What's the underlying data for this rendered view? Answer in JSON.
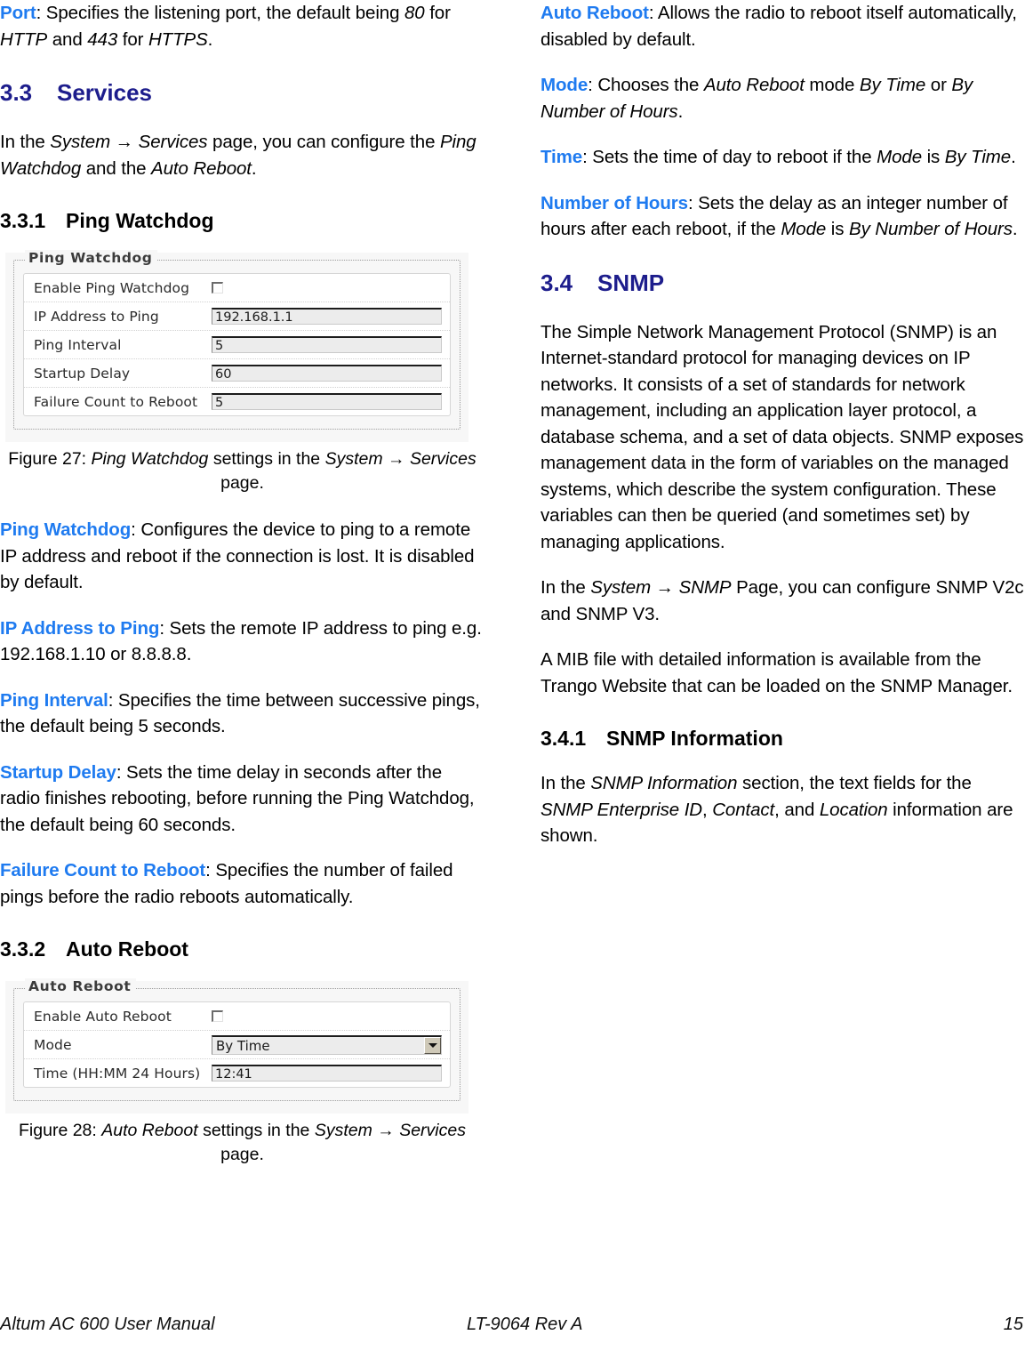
{
  "colors": {
    "term_blue": "#1f7bf0",
    "heading_navy": "#1d1d8c",
    "body_black": "#000000"
  },
  "left_column": {
    "port_para": {
      "term": "Port",
      "p1": ": Specifies the listening port, the default being ",
      "i1": "80",
      "p2": " for ",
      "i2": "HTTP",
      "p3": " and ",
      "i3": "443",
      "p4": " for ",
      "i4": "HTTPS",
      "p5": "."
    },
    "section_33": {
      "number": "3.3",
      "title": "Services"
    },
    "services_intro": {
      "p1": "In the ",
      "i1": "System",
      "arrow": " → ",
      "i2": "Services",
      "p2": " page, you can configure the ",
      "i3": "Ping Watchdog",
      "p3": " and the ",
      "i4": "Auto Reboot",
      "p4": "."
    },
    "heading_331": {
      "number": "3.3.1",
      "title": "Ping Watchdog"
    },
    "figure27": {
      "panel_title": "Ping Watchdog",
      "rows": [
        {
          "label": "Enable Ping Watchdog",
          "control": "checkbox",
          "value": ""
        },
        {
          "label": "IP Address to Ping",
          "control": "text",
          "value": "192.168.1.1"
        },
        {
          "label": "Ping Interval",
          "control": "text",
          "value": "5"
        },
        {
          "label": "Startup Delay",
          "control": "text",
          "value": "60"
        },
        {
          "label": "Failure Count to Reboot",
          "control": "text",
          "value": "5"
        }
      ],
      "caption": {
        "p1": "Figure 27: ",
        "i1": "Ping Watchdog",
        "p2": " settings in the ",
        "i2": "System",
        "arrow": " → ",
        "i3": "Services",
        "p3": " page."
      }
    },
    "ping_watchdog_para": {
      "term": "Ping Watchdog",
      "text": ": Configures the device to ping to a remote IP address and reboot if the connection is lost. It is disabled by default."
    },
    "ip_address_para": {
      "term": "IP Address to Ping",
      "text": ": Sets the remote IP address to ping e.g. 192.168.1.10 or 8.8.8.8."
    },
    "ping_interval_para": {
      "term": "Ping Interval",
      "text": ": Specifies the time between successive pings, the default being 5 seconds."
    },
    "startup_delay_para": {
      "term": "Startup Delay",
      "text": ": Sets the time delay in seconds after the radio finishes rebooting, before running the Ping Watchdog, the default being 60 seconds."
    },
    "failure_count_para": {
      "term": "Failure Count to Reboot",
      "text": ": Specifies the number of failed pings before the radio reboots automatically."
    },
    "heading_332": {
      "number": "3.3.2",
      "title": "Auto Reboot"
    },
    "figure28": {
      "panel_title": "Auto Reboot",
      "rows": [
        {
          "label": "Enable Auto Reboot",
          "control": "checkbox",
          "value": ""
        },
        {
          "label": "Mode",
          "control": "select",
          "value": "By Time"
        },
        {
          "label": "Time (HH:MM 24 Hours)",
          "control": "text",
          "value": "12:41"
        }
      ],
      "caption": {
        "p1": "Figure 28: ",
        "i1": "Auto Reboot",
        "p2": " settings in the ",
        "i2": "System",
        "arrow": " → ",
        "i3": "Services",
        "p3": " page."
      }
    }
  },
  "right_column": {
    "auto_reboot_para": {
      "term": "Auto Reboot",
      "text": ": Allows the radio to reboot itself automatically, disabled by default."
    },
    "mode_para": {
      "term": "Mode",
      "p1": ": Chooses the ",
      "i1": "Auto Reboot",
      "p2": " mode ",
      "i2": "By Time",
      "p3": " or ",
      "i3": "By Number of Hours",
      "p4": "."
    },
    "time_para": {
      "term": "Time",
      "p1": ": Sets the time of day to reboot if the ",
      "i1": "Mode",
      "p2": " is ",
      "i2": "By Time",
      "p3": "."
    },
    "hours_para": {
      "term": "Number of Hours",
      "p1": ": Sets the delay as an integer number of hours after each reboot, if the ",
      "i1": "Mode",
      "p2": " is ",
      "i2": "By Number of Hours",
      "p3": "."
    },
    "section_34": {
      "number": "3.4",
      "title": "SNMP"
    },
    "snmp_intro": "The Simple Network Management Protocol (SNMP) is an Internet-standard protocol for managing devices on IP networks. It consists of a set of standards for network management, including an application layer protocol, a database schema, and a set of data objects. SNMP exposes management data in the form of variables on the managed systems, which describe the system configuration. These variables can then be queried (and sometimes set) by managing applications.",
    "snmp_page_para": {
      "p1": "In the ",
      "i1": "System",
      "arrow": " → ",
      "i2": "SNMP",
      "p2": " Page, you can configure SNMP V2c and SNMP V3."
    },
    "mib_para": "A MIB file with detailed information is available from the Trango Website that can be loaded on the SNMP Manager.",
    "heading_341": {
      "number": "3.4.1",
      "title": "SNMP Information"
    },
    "snmp_info_para": {
      "p1": "In the ",
      "i1": "SNMP Information",
      "p2": " section, the text fields for the ",
      "i2": "SNMP Enterprise ID",
      "p3": ", ",
      "i3": "Contact",
      "p4": ", and ",
      "i4": "Location",
      "p5": " information are shown."
    }
  },
  "footer": {
    "left": "Altum AC 600 User Manual",
    "center": "LT-9064 Rev A",
    "right": "15"
  }
}
